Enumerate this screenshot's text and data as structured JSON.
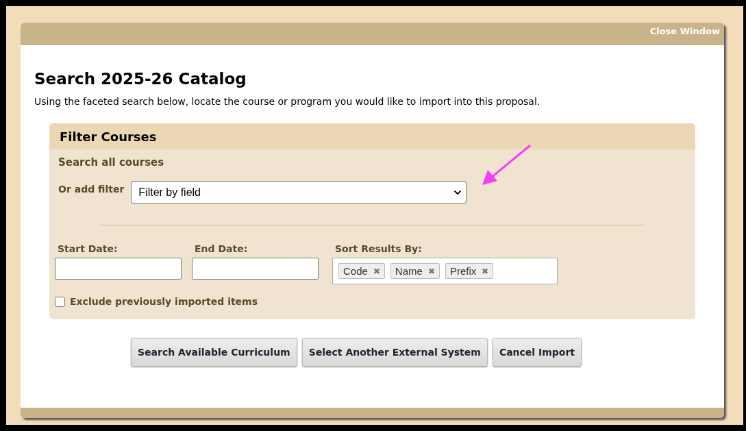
{
  "window": {
    "close_label": "Close Window",
    "title": "Search 2025-26 Catalog",
    "description": "Using the faceted search below, locate the course or program you would like to import into this proposal."
  },
  "filter_panel": {
    "title": "Filter Courses",
    "search_all_label": "Search all courses",
    "add_filter_label": "Or add filter",
    "filter_select": {
      "value": "Filter by field"
    },
    "start_date": {
      "label": "Start Date:"
    },
    "end_date": {
      "label": "End Date:"
    },
    "sort": {
      "label": "Sort Results By:",
      "tags": [
        {
          "label": "Code",
          "remove": "✖"
        },
        {
          "label": "Name",
          "remove": "✖"
        },
        {
          "label": "Prefix",
          "remove": "✖"
        }
      ]
    },
    "exclude": {
      "label": "Exclude previously imported items",
      "checked": false
    }
  },
  "buttons": [
    {
      "label": "Search Available Curriculum"
    },
    {
      "label": "Select Another External System"
    },
    {
      "label": "Cancel Import"
    }
  ]
}
